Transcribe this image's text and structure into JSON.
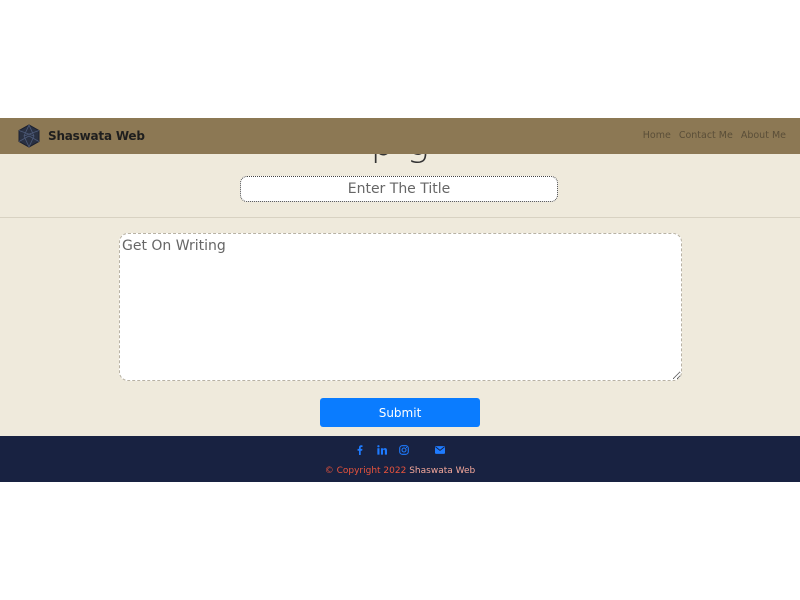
{
  "navbar": {
    "brand_name": "Shaswata Web",
    "links": [
      {
        "label": "Home"
      },
      {
        "label": "Contact Me"
      },
      {
        "label": "About Me"
      }
    ]
  },
  "form": {
    "heading_partial": "p                    g",
    "title_placeholder": "Enter The Title",
    "content_placeholder": "Get On Writing",
    "submit_label": "Submit"
  },
  "footer": {
    "social_icons": [
      "facebook-icon",
      "linkedin-icon",
      "instagram-icon",
      "email-icon"
    ],
    "copyright_prefix": "© Copyright 2022",
    "copyright_owner": "Shaswata Web"
  },
  "colors": {
    "navbar_bg": "#8c7854",
    "page_bg": "#efeadc",
    "footer_bg": "#182241",
    "submit_bg": "#0a7cff",
    "copyright_text": "#e8533c"
  }
}
